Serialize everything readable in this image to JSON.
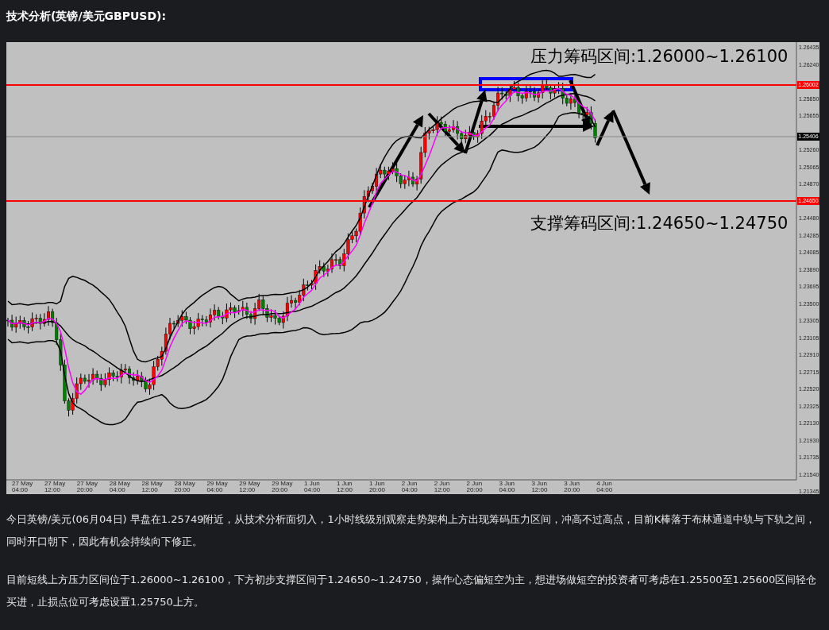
{
  "heading": "技术分析(英镑/美元GBPUSD):",
  "chart": {
    "annotations": [
      {
        "kind": "resistance",
        "text": "压力筹码区间:1.26000~1.26100"
      },
      {
        "kind": "support",
        "text": "支撑筹码区间:1.24650~1.24750"
      }
    ],
    "price_labels": [
      "1.26435",
      "1.26240",
      "1.25850",
      "1.25655",
      "1.25260",
      "1.25065",
      "1.24870",
      "1.24480",
      "1.24285",
      "1.24085",
      "1.23890",
      "1.23695",
      "1.23500",
      "1.23305",
      "1.23105",
      "1.22910",
      "1.22715",
      "1.22520",
      "1.22325",
      "1.22130",
      "1.21930",
      "1.21735",
      "1.21540",
      "1.21345"
    ],
    "price_markers": [
      {
        "kind": "resistance",
        "text": "1.26002"
      },
      {
        "kind": "current",
        "text": "1.25406"
      },
      {
        "kind": "support",
        "text": "1.24650"
      }
    ],
    "time_labels": [
      "27 May 04:00",
      "27 May 12:00",
      "27 May 20:00",
      "28 May 04:00",
      "28 May 12:00",
      "28 May 20:00",
      "29 May 04:00",
      "29 May 12:00",
      "29 May 20:00",
      "1 Jun 04:00",
      "1 Jun 12:00",
      "1 Jun 20:00",
      "2 Jun 04:00",
      "2 Jun 12:00",
      "2 Jun 20:00",
      "3 Jun 04:00",
      "3 Jun 12:00",
      "3 Jun 20:00",
      "4 Jun 04:00"
    ]
  },
  "paragraphs": [
    "今日英镑/美元(06月04日) 早盘在1.25749附近，从技术分析面切入，1小时线级别观察走势架构上方出现筹码压力区间，冲高不过高点，目前K棒落于布林通道中轨与下轨之间，同时开口朝下，因此有机会持续向下修正。",
    "目前短线上方压力区间位于1.26000~1.26100，下方初步支撑区间于1.24650~1.24750，操作心态偏短空为主，想进场做短空的投资者可考虑在1.25500至1.25600区间轻仓买进，止损点位可考虑设置1.25750上方。"
  ]
}
